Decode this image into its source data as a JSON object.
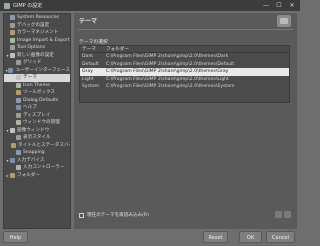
{
  "window": {
    "title": "GIMP の設定",
    "controls": [
      "—",
      "☐",
      "✕"
    ]
  },
  "sidebar": {
    "items": [
      {
        "label": "System Resources",
        "indent": 0,
        "expander": "",
        "icon": "c1"
      },
      {
        "label": "デバッグの設定",
        "indent": 0,
        "expander": "",
        "icon": "c3"
      },
      {
        "label": "カラーマネジメント",
        "indent": 0,
        "expander": "",
        "icon": "c2"
      },
      {
        "label": "Image Import & Export",
        "indent": 0,
        "expander": "",
        "icon": "c4"
      },
      {
        "label": "Tool Options",
        "indent": 0,
        "expander": "",
        "icon": "c3"
      },
      {
        "label": "新しい画像の設定",
        "indent": 0,
        "expander": "▾",
        "icon": "c6"
      },
      {
        "label": "グリッド",
        "indent": 1,
        "expander": "",
        "icon": "c3"
      },
      {
        "label": "ユーザーインターフェース",
        "indent": 0,
        "expander": "▾",
        "icon": "c5"
      },
      {
        "label": "テーマ",
        "indent": 1,
        "expander": "",
        "icon": "c6",
        "selected": true
      },
      {
        "label": "Icon Theme",
        "indent": 1,
        "expander": "",
        "icon": "c4"
      },
      {
        "label": "ツールボックス",
        "indent": 1,
        "expander": "",
        "icon": "c2"
      },
      {
        "label": "Dialog Defaults",
        "indent": 1,
        "expander": "",
        "icon": "c1"
      },
      {
        "label": "ヘルプ",
        "indent": 1,
        "expander": "",
        "icon": "c5"
      },
      {
        "label": "ディスプレイ",
        "indent": 1,
        "expander": "",
        "icon": "c3"
      },
      {
        "label": "ウィンドウの管理",
        "indent": 1,
        "expander": "",
        "icon": "c4"
      },
      {
        "label": "画像ウィンドウ",
        "indent": 0,
        "expander": "▾",
        "icon": "c6"
      },
      {
        "label": "表示スタイル",
        "indent": 1,
        "expander": "",
        "icon": "c3"
      },
      {
        "label": "タイトルとステータスバー",
        "indent": 1,
        "expander": "",
        "icon": "c2"
      },
      {
        "label": "Snapping",
        "indent": 1,
        "expander": "",
        "icon": "c1"
      },
      {
        "label": "入力デバイス",
        "indent": 0,
        "expander": "▾",
        "icon": "c5"
      },
      {
        "label": "入力コントローラー",
        "indent": 1,
        "expander": "",
        "icon": "c4"
      },
      {
        "label": "フォルダー",
        "indent": 0,
        "expander": "▸",
        "icon": "c2"
      }
    ]
  },
  "page": {
    "title": "テーマ",
    "section_label": "テーマの選択",
    "theme_table": {
      "headers": {
        "theme": "テーマ",
        "folder": "フォルダー"
      },
      "rows": [
        {
          "theme": "Dark",
          "folder": "C:\\Program Files\\GIMP 2\\share\\gimp\\2.0\\themes\\Dark"
        },
        {
          "theme": "Default",
          "folder": "C:\\Program Files\\GIMP 2\\share\\gimp\\2.0\\themes\\Default"
        },
        {
          "theme": "Gray",
          "folder": "C:\\Program Files\\GIMP 2\\share\\gimp\\2.0\\themes\\Gray",
          "selected": true
        },
        {
          "theme": "Light",
          "folder": "C:\\Program Files\\GIMP 2\\share\\gimp\\2.0\\themes\\Light"
        },
        {
          "theme": "System",
          "folder": "C:\\Program Files\\GIMP 2\\share\\gimp\\2.0\\themes\\System"
        }
      ]
    },
    "reload_checkbox": "現在のテーマを再読み込み(R)"
  },
  "buttons": {
    "help": "Help",
    "reset": "Reset",
    "ok": "OK",
    "cancel": "Cancel"
  }
}
